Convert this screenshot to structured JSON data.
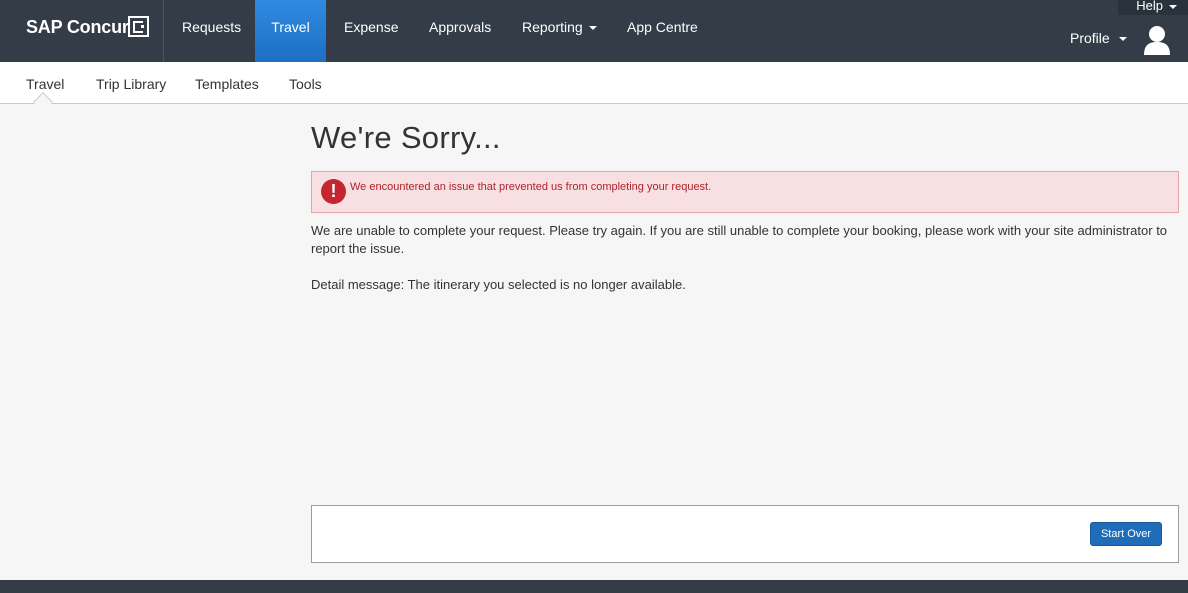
{
  "brand": {
    "name": "SAP Concur"
  },
  "top_nav": {
    "items": [
      {
        "label": "Requests"
      },
      {
        "label": "Travel",
        "active": true
      },
      {
        "label": "Expense"
      },
      {
        "label": "Approvals"
      },
      {
        "label": "Reporting",
        "has_dropdown": true
      },
      {
        "label": "App Centre"
      }
    ],
    "help_label": "Help",
    "profile_label": "Profile",
    "avatar_icon": "user-avatar-icon"
  },
  "sub_nav": {
    "items": [
      {
        "label": "Travel",
        "active": true
      },
      {
        "label": "Trip Library"
      },
      {
        "label": "Templates"
      },
      {
        "label": "Tools"
      }
    ]
  },
  "main": {
    "title": "We're Sorry...",
    "alert": {
      "icon": "exclamation-icon",
      "text": "We encountered an issue that prevented us from completing your request."
    },
    "message": "We are unable to complete your request. Please try again. If you are still unable to complete your booking, please work with your site administrator to report the issue.",
    "detail": "Detail message: The itinerary you selected is no longer available.",
    "start_over_label": "Start Over"
  },
  "colors": {
    "header_bg": "#333c47",
    "active_tab": "#1d6fc2",
    "alert_bg": "#f8dfe1",
    "alert_text": "#b1232b",
    "button_bg": "#1f6db8"
  }
}
